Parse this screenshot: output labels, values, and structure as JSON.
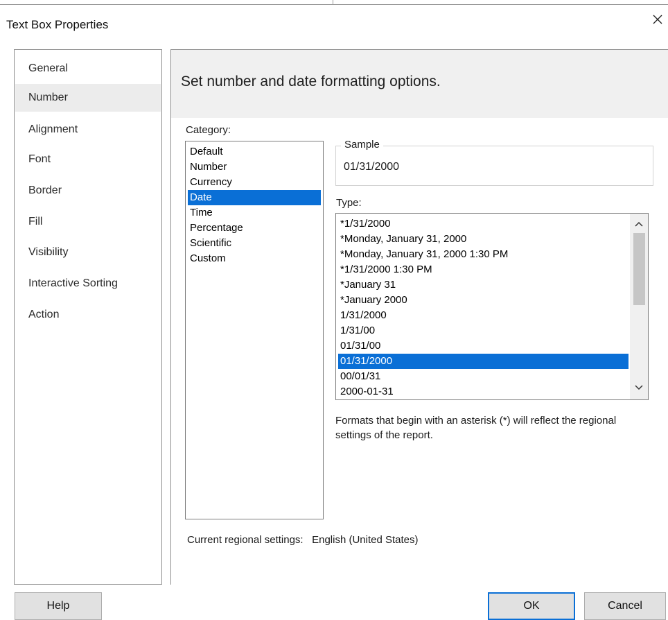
{
  "window": {
    "title": "Text Box Properties"
  },
  "nav": {
    "items": [
      {
        "label": "General"
      },
      {
        "label": "Number"
      },
      {
        "label": "Alignment"
      },
      {
        "label": "Font"
      },
      {
        "label": "Border"
      },
      {
        "label": "Fill"
      },
      {
        "label": "Visibility"
      },
      {
        "label": "Interactive Sorting"
      },
      {
        "label": "Action"
      }
    ],
    "selected": "Number"
  },
  "page": {
    "heading": "Set number and date formatting options."
  },
  "category": {
    "label": "Category:",
    "items": [
      "Default",
      "Number",
      "Currency",
      "Date",
      "Time",
      "Percentage",
      "Scientific",
      "Custom"
    ],
    "selected": "Date"
  },
  "sample": {
    "label": "Sample",
    "value": "01/31/2000"
  },
  "type": {
    "label": "Type:",
    "items": [
      "*1/31/2000",
      "*Monday, January 31, 2000",
      "*Monday, January 31, 2000 1:30 PM",
      "*1/31/2000 1:30 PM",
      "*January 31",
      "*January 2000",
      "1/31/2000",
      "1/31/00",
      "01/31/00",
      "01/31/2000",
      "00/01/31",
      "2000-01-31"
    ],
    "selected": "01/31/2000"
  },
  "info": {
    "text": "Formats that begin with an asterisk (*) will reflect the regional settings of the report."
  },
  "regional": {
    "label": "Current regional settings:",
    "value": "English (United States)"
  },
  "buttons": {
    "help": "Help",
    "ok": "OK",
    "cancel": "Cancel"
  },
  "colors": {
    "selection": "#0a6fd6",
    "nav_selected": "#ececec",
    "header_band": "#f0f0f0"
  },
  "icons": {
    "close": "close-icon",
    "scroll_up": "chevron-up-icon",
    "scroll_down": "chevron-down-icon"
  }
}
